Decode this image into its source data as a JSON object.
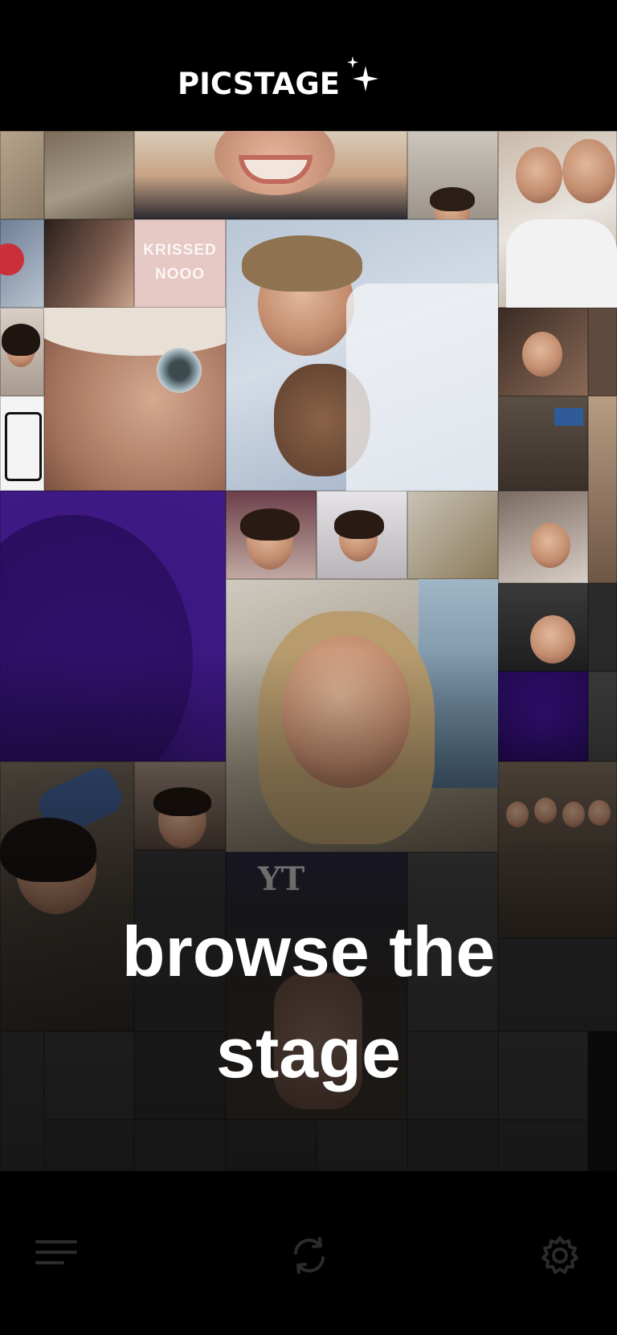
{
  "app": {
    "brand": "PICSTAGE"
  },
  "tile_caption": {
    "line1": "KRISSED",
    "line2": "NOOO"
  },
  "headline": {
    "line1": "browse the",
    "line2": "stage"
  },
  "nav": {
    "left_icon": "menu-icon",
    "center_icon": "refresh-icon",
    "right_icon": "gear-icon"
  },
  "colors": {
    "background": "#000000",
    "text": "#ffffff",
    "accent_purple": "#3b1780"
  }
}
